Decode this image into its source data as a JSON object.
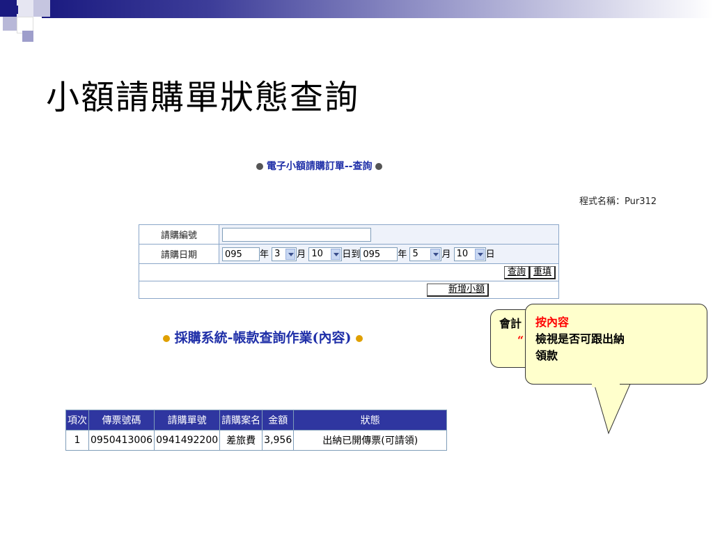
{
  "slide_title": "小額請購單狀態查詢",
  "app_title": "電子小額請購訂單--查詢",
  "program_name": "程式名稱：Pur312",
  "form": {
    "request_no_label": "請購編號",
    "request_no_value": "",
    "date_label": "請購日期",
    "from_year": "095",
    "year_unit": "年",
    "from_month": "3",
    "month_unit": "月",
    "from_day": "10",
    "day_to_unit": "日到",
    "to_year": "095",
    "to_month": "5",
    "to_day": "10",
    "day_unit": "日",
    "query_button": "查詢",
    "reset_button": "重填",
    "add_button": "新增小額"
  },
  "subtitle": "採購系統-帳款查詢作業(內容)",
  "results": {
    "headers": [
      "項次",
      "傳票號碼",
      "請購單號",
      "請購案名",
      "金額",
      "狀態"
    ],
    "rows": [
      [
        "1",
        "0950413006",
        "0941492200",
        "差旅費",
        "3,956",
        "出納已開傳票(可請領)"
      ]
    ]
  },
  "callout_back": {
    "line1": "會計",
    "line2": "“"
  },
  "callout_front": {
    "highlight": "按內容",
    "text_line1": "檢視是否可跟出納",
    "text_line2": "領款",
    "highlight_color": "#ff0000",
    "background_color": "#ffffcc"
  },
  "colors": {
    "header_bar": "#1a1a80",
    "table_header": "#2f36a0",
    "title_blue": "#1f2fa8"
  }
}
